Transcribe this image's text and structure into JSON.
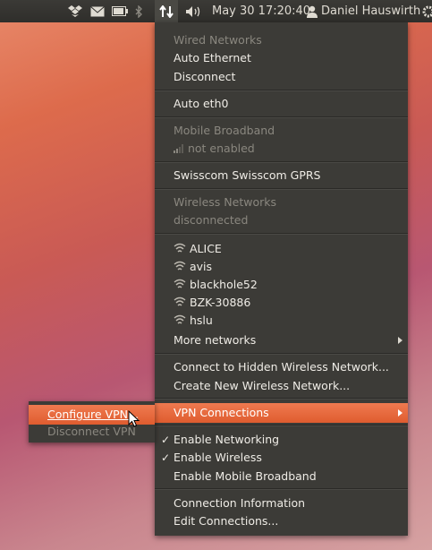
{
  "topbar": {
    "datetime": "May 30 17:20:40",
    "user": "Daniel Hauswirth",
    "icons": [
      "dropbox-icon",
      "mail-icon",
      "battery-icon",
      "bluetooth-icon",
      "network-icon",
      "volume-icon",
      "user-icon",
      "gear-icon"
    ]
  },
  "menu": {
    "wired_header": "Wired Networks",
    "auto_ethernet": "Auto Ethernet",
    "disconnect": "Disconnect",
    "auto_eth0": "Auto eth0",
    "mobile_header": "Mobile Broadband",
    "mobile_status": "not enabled",
    "swisscom": "Swisscom Swisscom GPRS",
    "wireless_header": "Wireless Networks",
    "wireless_status": "disconnected",
    "networks": [
      "ALICE",
      "avis",
      "blackhole52",
      "BZK-30886",
      "hslu"
    ],
    "more_networks": "More networks",
    "connect_hidden": "Connect to Hidden Wireless Network...",
    "create_new": "Create New Wireless Network...",
    "vpn_connections": "VPN Connections",
    "enable_networking": "Enable Networking",
    "enable_wireless": "Enable Wireless",
    "enable_mobile": "Enable Mobile Broadband",
    "connection_info": "Connection Information",
    "edit_connections": "Edit Connections..."
  },
  "vpn_submenu": {
    "configure": "Configure VPN...",
    "disconnect": "Disconnect VPN"
  },
  "colors": {
    "panel": "#3c3b37",
    "highlight": "#e4643a",
    "text": "#efece6",
    "dim_text": "#8a877f"
  }
}
